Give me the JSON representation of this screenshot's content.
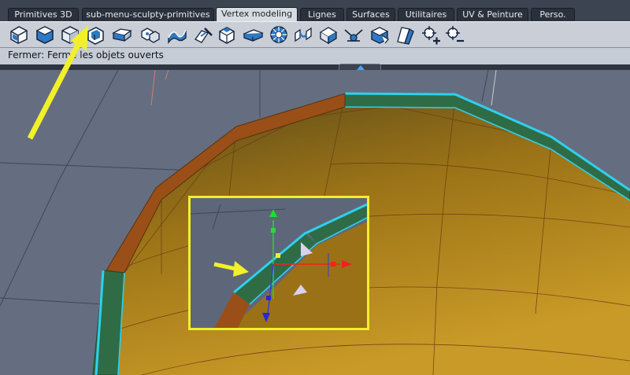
{
  "tabs": [
    {
      "label": "Primitives 3D",
      "active": false
    },
    {
      "label": "sub-menu-sculpty-primitives",
      "active": false
    },
    {
      "label": "Vertex modeling",
      "active": true
    },
    {
      "label": "Lignes",
      "active": false
    },
    {
      "label": "Surfaces",
      "active": false
    },
    {
      "label": "Utilitaires",
      "active": false
    },
    {
      "label": "UV & Peinture",
      "active": false
    },
    {
      "label": "Perso.",
      "active": false
    }
  ],
  "toolbar": {
    "tools": [
      "close-objects-icon",
      "extrude-face-icon",
      "cube-tool-icon",
      "open-close-icon",
      "plane-insert-icon",
      "explode-icon",
      "smooth-surface-icon",
      "knife-icon",
      "bevel-icon",
      "slice-icon",
      "sphere-grid-icon",
      "bridge-icon",
      "paint-vertex-icon",
      "weld-icon",
      "shell-icon",
      "cut-icon",
      "add-point-icon",
      "zoom-point-icon"
    ]
  },
  "status": {
    "text": "Fermer: Ferme les objets ouverts"
  },
  "colors": {
    "highlight_edge": "#2fd0ee",
    "annotation_arrow": "#f3f02a",
    "inset_border": "#f2ef2c",
    "shell_green": "#2f7a4d",
    "shell_orange": "#a8571a",
    "bowl_interior": "#b68a21"
  }
}
